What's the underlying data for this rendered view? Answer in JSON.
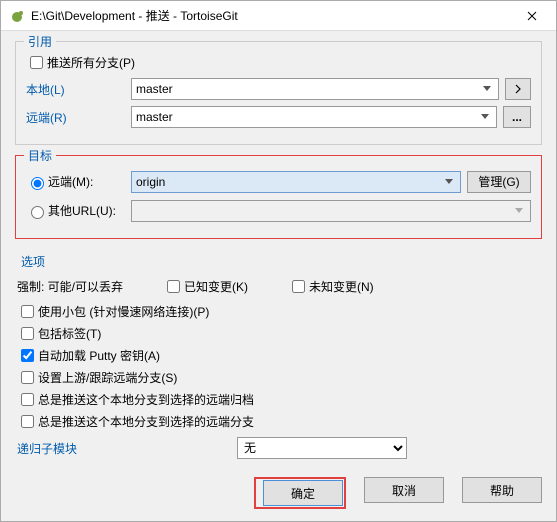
{
  "titlebar": {
    "title": "E:\\Git\\Development - 推送 - TortoiseGit"
  },
  "ref": {
    "group": "引用",
    "push_all": "推送所有分支(P)",
    "local_label": "本地(L)",
    "local_value": "master",
    "remote_label": "远端(R)",
    "remote_value": "master"
  },
  "dest": {
    "group": "目标",
    "remote_radio": "远端(M):",
    "remote_value": "origin",
    "manage": "管理(G)",
    "other_radio": "其他URL(U):",
    "other_value": ""
  },
  "opts": {
    "group": "选项",
    "force_label": "强制: 可能/可以丢弃",
    "known_changes": "已知变更(K)",
    "unknown_changes": "未知变更(N)",
    "thin_pack": "使用小包 (针对慢速网络连接)(P)",
    "include_tags": "包括标签(T)",
    "autoload_putty": "自动加载 Putty 密钥(A)",
    "set_upstream": "设置上游/跟踪远端分支(S)",
    "always_archive": "总是推送这个本地分支到选择的远端归档",
    "always_branch": "总是推送这个本地分支到选择的远端分支",
    "submodule_label": "递归子模块",
    "submodule_value": "无"
  },
  "buttons": {
    "ok": "确定",
    "cancel": "取消",
    "help": "帮助"
  }
}
